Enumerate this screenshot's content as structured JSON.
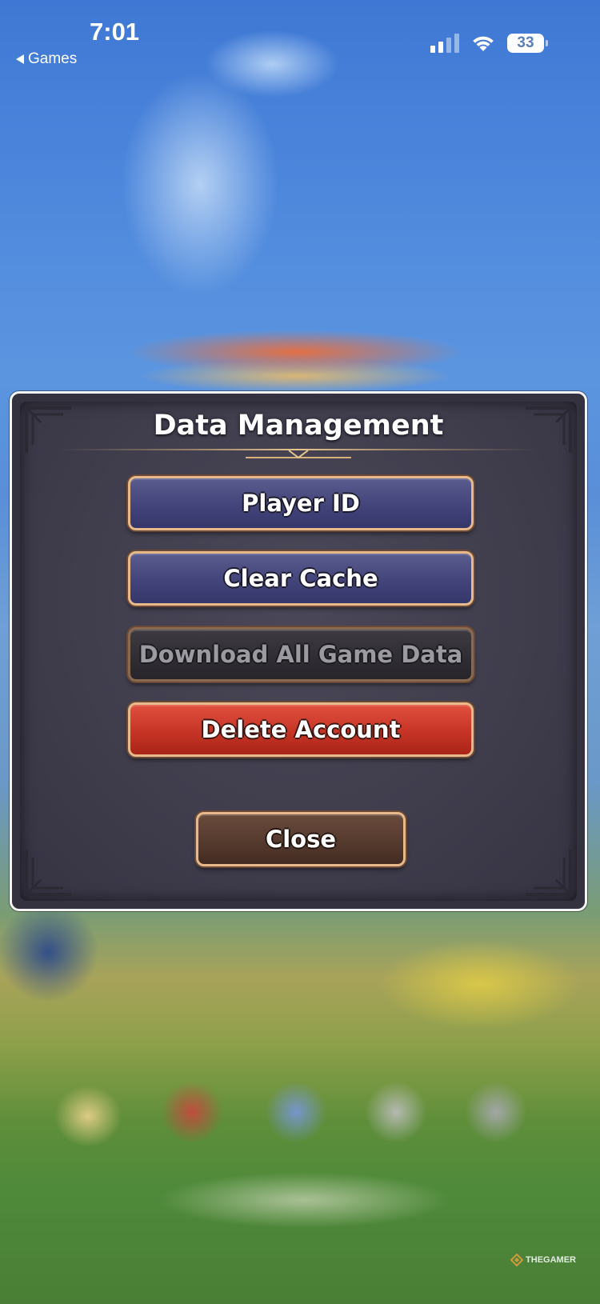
{
  "status_bar": {
    "time": "7:01",
    "back_label": "Games",
    "battery_level": "33",
    "signal_bars_active": 2,
    "signal_bars_total": 4
  },
  "dialog": {
    "title": "Data Management",
    "buttons": {
      "player_id": "Player ID",
      "clear_cache": "Clear Cache",
      "download_all": "Download All Game Data",
      "delete_account": "Delete Account",
      "close": "Close"
    }
  },
  "watermark": {
    "text": "THEGAMER"
  },
  "colors": {
    "dialog_bg": "#403e4d",
    "button_blue": "#43447a",
    "button_red": "#c63426",
    "button_brown": "#553a2e",
    "button_border": "#e7b98b"
  }
}
